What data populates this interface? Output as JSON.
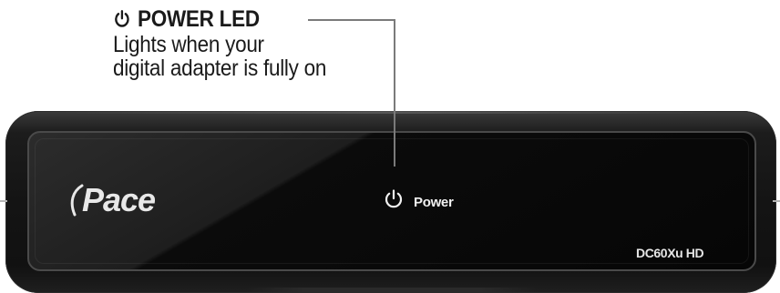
{
  "callout": {
    "icon": "power-icon",
    "title": "POWER LED",
    "description_line1": "Lights when your",
    "description_line2": "digital adapter is fully on"
  },
  "device": {
    "brand": "Pace",
    "power_icon": "power-icon",
    "power_label": "Power",
    "model": "DC60Xu HD"
  }
}
